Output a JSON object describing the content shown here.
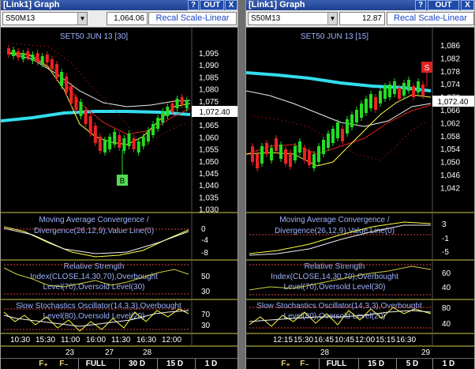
{
  "windows": [
    {
      "title": "[Link1] Graph",
      "help_label": "?",
      "out_label": "OUT",
      "close_label": "X",
      "symbol": "S50M13",
      "price_box": "1,064.06",
      "recal_label": "Recal Scale-Linear",
      "chart_title": "SET50 JUN 13   [30]",
      "price_axis": [
        "1,095",
        "1,090",
        "1,085",
        "1,080",
        "1,075",
        "1,070",
        "1,065",
        "1,060",
        "1,055",
        "1,050",
        "1,045",
        "1,040",
        "1,035",
        "1,030"
      ],
      "last_price": "1,072.40",
      "marker": "B",
      "macd_label_1": "Moving Average Convergence /",
      "macd_label_2": "Divergence(26,12,9),Value Line(0)",
      "macd_axis": [
        "0",
        "-4",
        "-8"
      ],
      "rsi_label_1": "Relative Strength",
      "rsi_label_2": "Index(CLOSE,14,30,70),Overbought",
      "rsi_label_3": "Level(70),Oversold Level(30)",
      "rsi_axis": [
        "50",
        "30"
      ],
      "stoch_label_1": "Slow Stochastics Oscillator(14,3,3),Overbought",
      "stoch_label_2": "Level(80),Oversold Level(20)",
      "stoch_axis": [
        "70",
        "30"
      ],
      "times": [
        "10:30",
        "15:30",
        "11:00",
        "16:00",
        "11:30",
        "16:30",
        "12:00"
      ],
      "dates": [
        "23",
        "27",
        "28"
      ],
      "tabs": [
        "FULL",
        "30 D",
        "15 D",
        "1 D"
      ]
    },
    {
      "title": "[Link1] Graph",
      "help_label": "?",
      "out_label": "OUT",
      "close_label": "X",
      "symbol": "S50M13",
      "price_box": "12.87",
      "recal_label": "Recal Scale-Linear",
      "chart_title": "SET50 JUN 13   [15]",
      "price_axis": [
        "1,086",
        "1,082",
        "1,078",
        "1,074",
        "1,070",
        "1,066",
        "1,062",
        "1,058",
        "1,054",
        "1,050",
        "1,046",
        "1,042"
      ],
      "last_price": "1,072.40",
      "marker": "S",
      "macd_label_1": "Moving Average Convergence /",
      "macd_label_2": "Divergence(26,12,9),Value Line(0)",
      "macd_axis": [
        "3",
        "-1",
        "-5"
      ],
      "rsi_label_1": "Relative Strength",
      "rsi_label_2": "Index(CLOSE,14,30,70),Overbought",
      "rsi_label_3": "Level(70),Oversold Level(30)",
      "rsi_axis": [
        "60",
        "40"
      ],
      "stoch_label_1": "Slow Stochastics Oscillator(14,3,3),Overbought",
      "stoch_label_2": "Level(80),Oversold Level(20)",
      "stoch_axis": [
        "80",
        "40"
      ],
      "times": [
        "12:15",
        "15:30",
        "16:45",
        "10:45",
        "12:00",
        "15:15",
        "16:30"
      ],
      "dates": [
        "28",
        "29"
      ],
      "tabs": [
        "FULL",
        "15 D",
        "5 D",
        "1 D"
      ]
    }
  ],
  "colors": {
    "bull": "#22dd22",
    "bear": "#ee2222",
    "cyan": "#33ddee",
    "yellow": "#ffff44",
    "ma_red": "#e02020",
    "ma_white": "#f0f0f0"
  }
}
